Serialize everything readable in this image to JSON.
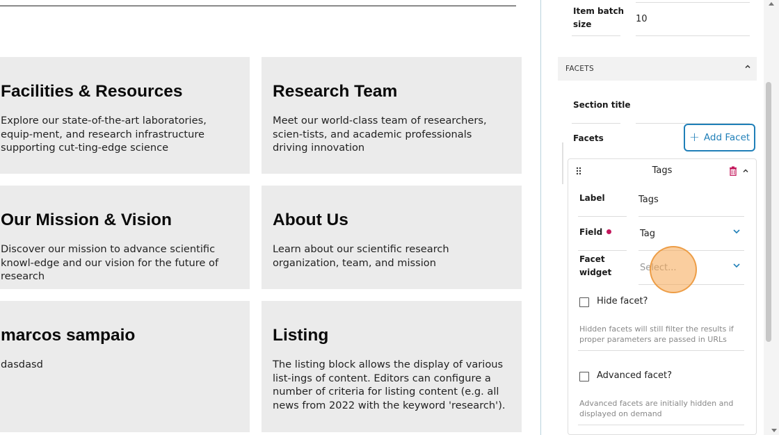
{
  "cards": [
    {
      "title": "Facilities & Resources",
      "text": "Explore our state-of-the-art laboratories, equip-ment, and research infrastructure supporting cut-ting-edge science"
    },
    {
      "title": "Research Team",
      "text": "Meet our world-class team of researchers, scien-tists, and academic professionals driving innovation"
    },
    {
      "title": "Our Mission & Vision",
      "text": "Discover our mission to advance scientific knowl-edge and our vision for the future of research"
    },
    {
      "title": "About Us",
      "text": "Learn about our scientific research organization, team, and mission"
    },
    {
      "title": "marcos sampaio",
      "text": "dasdasd"
    },
    {
      "title": "Listing",
      "text": "The listing block allows the display of various list-ings of content. Editors can configure a number of criteria for listing content (e.g. all news from 2022 with the keyword 'research')."
    }
  ],
  "sidebar": {
    "item_batch_size": {
      "label_line1": "Item batch",
      "label_line2": "size",
      "value": "10"
    },
    "facets_section": {
      "header": "FACETS"
    },
    "section_title": {
      "label": "Section title",
      "value": ""
    },
    "facets": {
      "label": "Facets",
      "add_button": "Add Facet"
    },
    "facet_item": {
      "title": "Tags",
      "label_field": {
        "label": "Label",
        "value": "Tags"
      },
      "field_field": {
        "label": "Field",
        "value": "Tag",
        "required": true
      },
      "widget_field": {
        "label_line1": "Facet",
        "label_line2": "widget",
        "placeholder": "Select..."
      },
      "hide_facet": {
        "label": "Hide facet?",
        "help": "Hidden facets will still filter the results if proper parameters are passed in URLs",
        "checked": false
      },
      "advanced_facet": {
        "label": "Advanced facet?",
        "help": "Advanced facets are initially hidden and displayed on demand",
        "checked": false
      }
    }
  },
  "colors": {
    "accent": "#1f7fb8",
    "danger": "#c3185c",
    "card_bg": "#ebebeb"
  },
  "icons": [
    "plus-icon",
    "drag-handle-icon",
    "trash-icon",
    "chevron-up-icon",
    "chevron-down-icon"
  ]
}
